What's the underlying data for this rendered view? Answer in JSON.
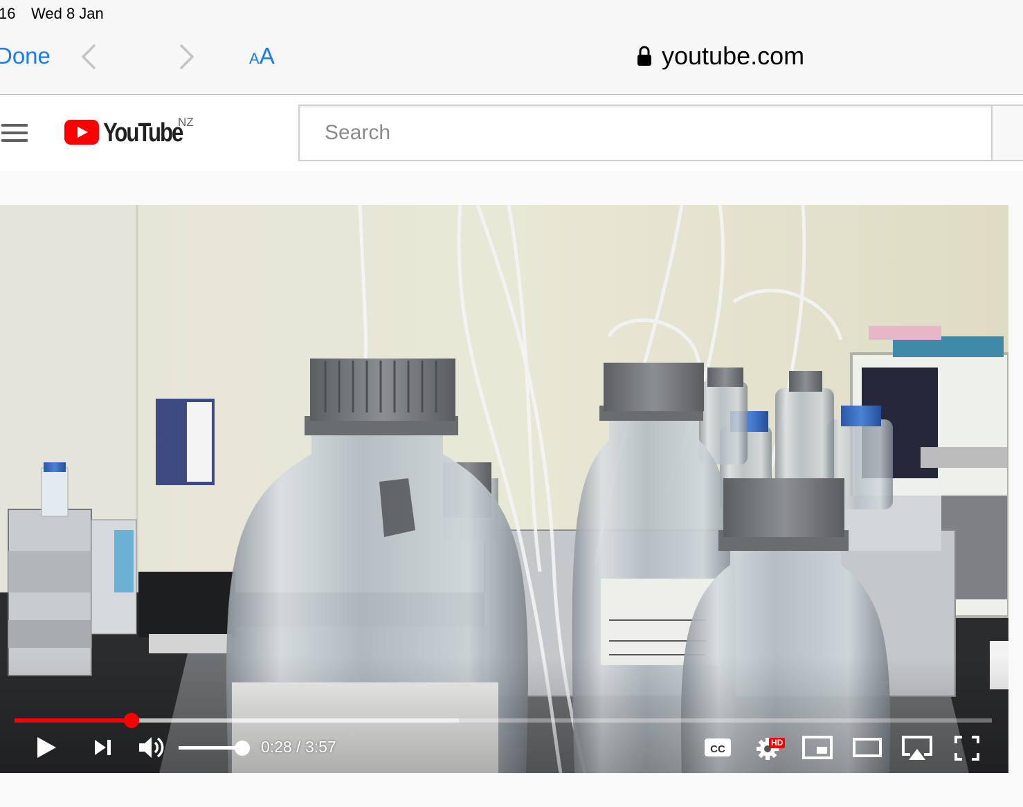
{
  "status_bar": {
    "time": "16",
    "date": "Wed 8 Jan"
  },
  "browser": {
    "done_label": "Done",
    "text_size_small": "A",
    "text_size_large": "A",
    "url": "youtube.com",
    "icons": [
      "back-icon",
      "forward-icon",
      "lock-icon"
    ]
  },
  "youtube": {
    "logo_text": "YouTube",
    "country_code": "NZ",
    "search_placeholder": "Search",
    "search_value": ""
  },
  "player": {
    "current_time": "0:28",
    "duration": "3:57",
    "time_separator": " / ",
    "progress_fraction": 0.12,
    "buffered_fraction": 0.455,
    "volume_fraction": 1.0,
    "hd_badge": "HD",
    "accent_color": "#ff0000",
    "icons": [
      "play-icon",
      "next-icon",
      "volume-icon",
      "captions-icon",
      "settings-icon",
      "miniplayer-icon",
      "theater-icon",
      "airplay-icon",
      "fullscreen-icon"
    ]
  }
}
